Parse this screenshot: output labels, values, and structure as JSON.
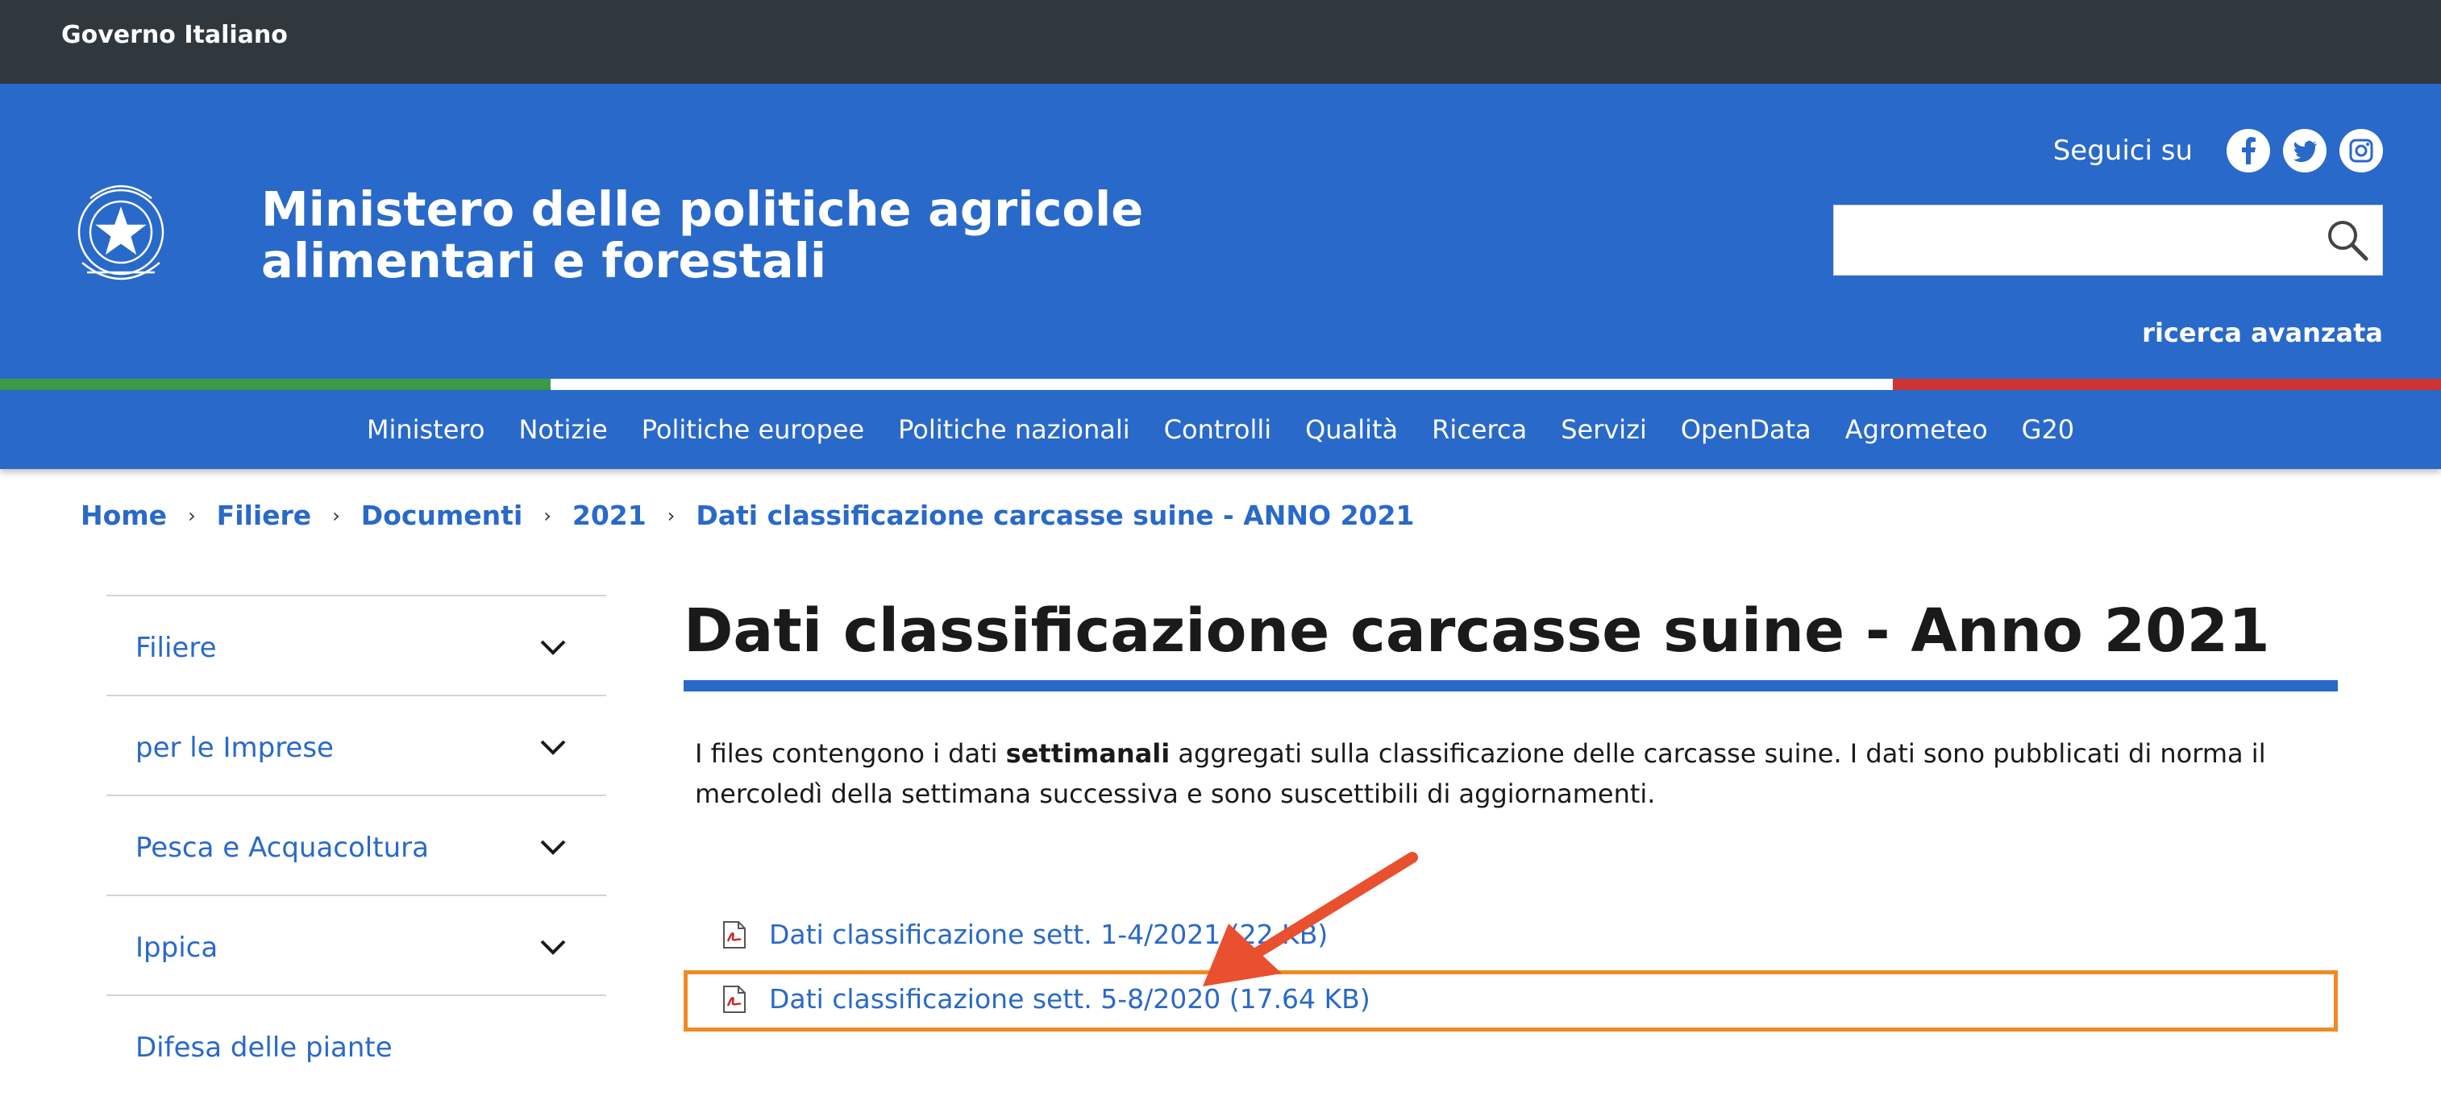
{
  "gov_bar": {
    "label": "Governo Italiano"
  },
  "header": {
    "title_line1": "Ministero delle politiche agricole",
    "title_line2": "alimentari e forestali",
    "follow_label": "Seguici su",
    "social_icons": [
      "facebook-icon",
      "twitter-icon",
      "instagram-icon"
    ],
    "search_value": "",
    "advanced_search": "ricerca avanzata"
  },
  "nav": {
    "items": [
      "Ministero",
      "Notizie",
      "Politiche europee",
      "Politiche nazionali",
      "Controlli",
      "Qualità",
      "Ricerca",
      "Servizi",
      "OpenData",
      "Agrometeo",
      "G20"
    ]
  },
  "breadcrumb": {
    "items": [
      "Home",
      "Filiere",
      "Documenti",
      "2021",
      "Dati classificazione carcasse suine - ANNO 2021"
    ]
  },
  "sidebar": {
    "items": [
      "Filiere",
      "per le Imprese",
      "Pesca e Acquacoltura",
      "Ippica",
      "Difesa delle piante"
    ]
  },
  "main": {
    "title": "Dati classificazione carcasse suine - Anno 2021",
    "intro_before": "I files contengono i dati ",
    "intro_bold": "settimanali",
    "intro_after": " aggregati sulla classificazione delle carcasse suine. I dati sono pubblicati di norma il mercoledì della settimana successiva e sono suscettibili di aggiornamenti.",
    "documents": [
      {
        "label": "Dati classificazione sett. 1-4/2021 (22 KB)"
      },
      {
        "label": "Dati classificazione sett. 5-8/2020 (17.64 KB)"
      }
    ]
  },
  "colors": {
    "brand_blue": "#2969c9",
    "gov_bar": "#30373d",
    "highlight_orange": "#f08a24",
    "arrow_red": "#e8502f"
  }
}
